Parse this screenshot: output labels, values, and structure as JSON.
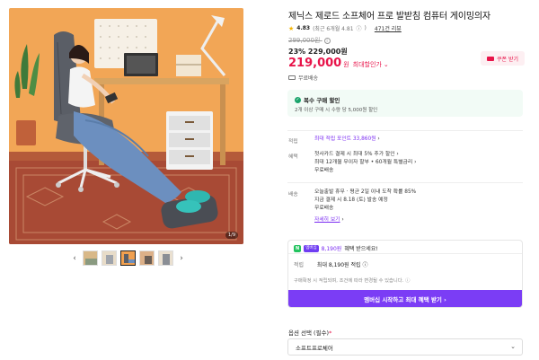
{
  "gallery": {
    "photo_counter": "1/9",
    "prev_arrow": "‹",
    "next_arrow": "›"
  },
  "product": {
    "title": "제닉스 제로드 소프체어 프로 발받침 컴퓨터 게이밍의자",
    "star_glyph": "★",
    "rating_score": "4.83",
    "rating_note": "(최근 6개월 4.81",
    "rating_info_glyph": "ⓘ",
    "rating_close": ")",
    "review_count": "471건 리뷰",
    "original_price": "299,000원",
    "discount": "23% 229,000원",
    "sale_price": "219,000",
    "sale_won": "원",
    "sale_label": "최대할인가",
    "sale_chevron": "⌄",
    "coupon_label": "쿠폰 받기",
    "shipping": "무료배송"
  },
  "multi_discount": {
    "title": "복수 구매 할인",
    "check_glyph": "✓",
    "description": "2개 이상 구매 시 수량 당 5,000원 할인"
  },
  "benefits": {
    "points_label": "적립",
    "points_value": "최대 적립 포인트 33,860원",
    "points_chevron": "›",
    "perks_label": "혜택",
    "perks_lines": [
      "첫사카드 결제 시 최대 5% 추가 할인 ›",
      "최대 12개월 무이자 할부 • 60개월 특별금리 ›",
      "무료배송"
    ],
    "delivery_label": "배송",
    "delivery_lines": [
      "오늘출발 휴무 · 평균 2일 이내 도착 확률 85%",
      "지금 결제 시 8.18 (토) 발송 예정",
      "무료배송"
    ],
    "detail_link": "자세히 보기",
    "detail_chevron": "›"
  },
  "membership": {
    "n_badge": "N",
    "plus_badge": "멤버십",
    "amount": "8,190원",
    "headline": "혜택 받으세요!",
    "row_label": "적립",
    "row_value": "최대 8,190원 적립",
    "row_info": "ⓘ",
    "note": "구매확정 시 적립되며, 조건에 따라 변경될 수 있습니다.",
    "note_info": "ⓘ",
    "cta": "멤버십 시작하고 최대 혜택 받기 ›"
  },
  "options": {
    "label": "옵션 선택 (필수)",
    "required_mark": "*",
    "selected": "소프트프로체어",
    "chevron": "⌄"
  },
  "colors": {
    "accent_red": "#e8144a",
    "accent_purple": "#7b3df5",
    "naver_green": "#22c35e",
    "wall_orange": "#f0a050"
  }
}
